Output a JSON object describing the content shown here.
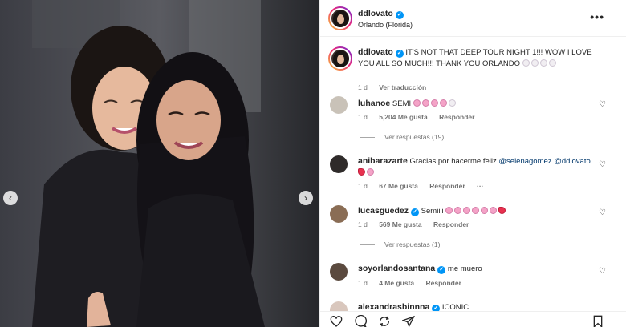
{
  "post": {
    "username": "ddlovato",
    "location": "Orlando (Florida)",
    "caption_user": "ddlovato",
    "caption_text": "IT'S NOT THAT DEEP TOUR NIGHT 1!!! WOW I LOVE YOU ALL SO MUCH!!! THANK YOU ORLANDO",
    "caption_time": "1 d",
    "see_translation": "Ver traducción"
  },
  "comments": [
    {
      "user": "luhanoe",
      "text": "SEMI",
      "time": "1 d",
      "likes": "5,204 Me gusta",
      "reply": "Responder",
      "replies_label": "Ver respuestas (19)"
    },
    {
      "user": "anibarazarte",
      "text": "Gracias por hacerme feliz",
      "mention1": "@selenagomez",
      "mention2": "@ddlovato",
      "time": "1 d",
      "likes": "67 Me gusta",
      "reply": "Responder"
    },
    {
      "user": "lucasguedez",
      "text": "Semiiii",
      "time": "1 d",
      "likes": "569 Me gusta",
      "reply": "Responder",
      "replies_label": "Ver respuestas (1)"
    },
    {
      "user": "soyorlandosantana",
      "text": "me muero",
      "time": "1 d",
      "likes": "4 Me gusta",
      "reply": "Responder"
    },
    {
      "user": "alexandrasbinnna",
      "text": "ICONIC"
    }
  ],
  "icons": [
    "chevron-left-icon",
    "chevron-right-icon",
    "more-icon",
    "heart-icon",
    "comment-icon",
    "share-icon",
    "send-icon",
    "bookmark-icon",
    "verified-icon"
  ],
  "colors": {
    "verified": "#0095f6",
    "muted": "#737373",
    "mention": "#00376b",
    "heart": "#e8314f"
  }
}
